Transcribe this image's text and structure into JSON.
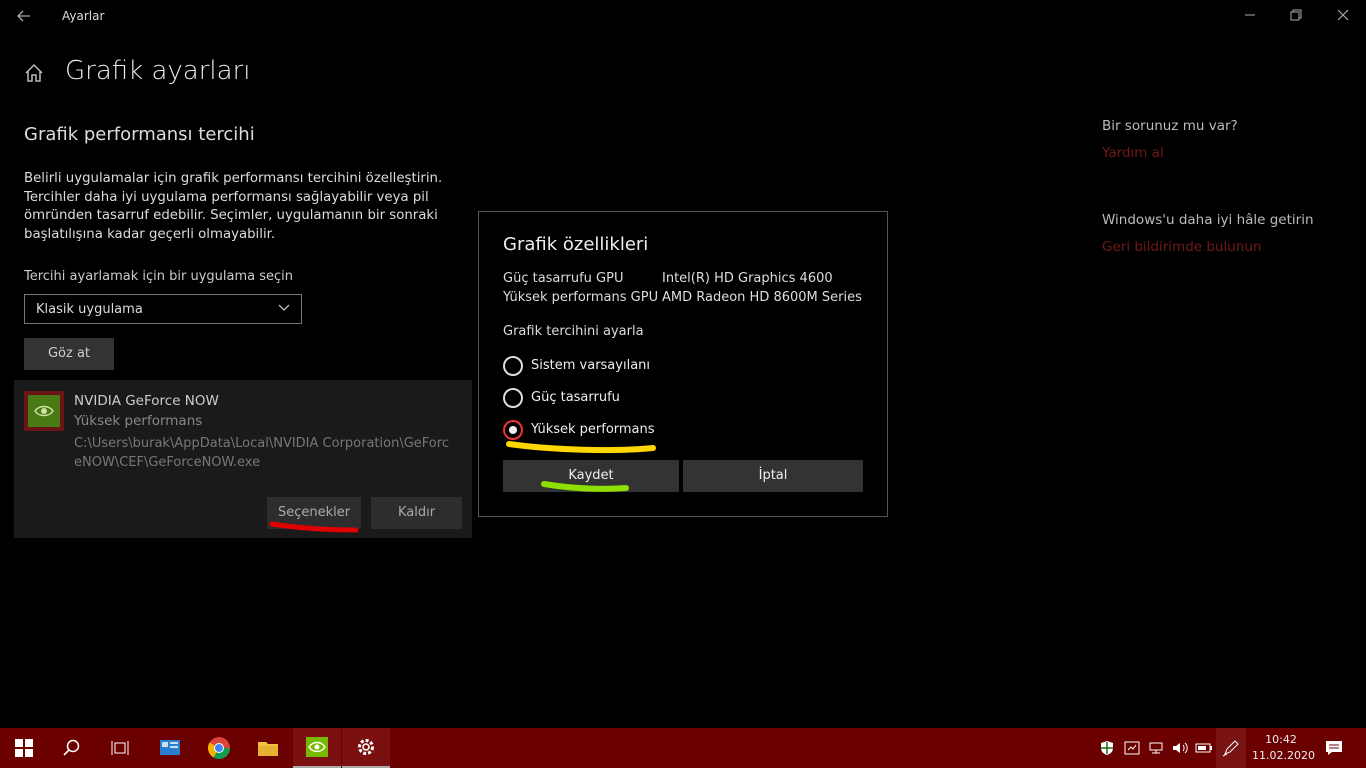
{
  "window": {
    "title": "Ayarlar",
    "icons": [
      "back-arrow-icon",
      "minimize-icon",
      "restore-icon",
      "close-icon"
    ]
  },
  "page": {
    "title": "Grafik ayarları",
    "section_title": "Grafik performansı tercihi",
    "description": "Belirli uygulamalar için grafik performansı tercihini özelleştirin. Tercihler daha iyi uygulama performansı sağlayabilir veya pil ömründen tasarruf edebilir. Seçimler, uygulamanın bir sonraki başlatılışına kadar geçerli olmayabilir.",
    "select_label": "Tercihi ayarlamak için bir uygulama seçin",
    "select_value": "Klasik uygulama",
    "browse_button": "Göz at"
  },
  "app_card": {
    "name": "NVIDIA GeForce NOW",
    "preference": "Yüksek performans",
    "path": "C:\\Users\\burak\\AppData\\Local\\NVIDIA Corporation\\GeForceNOW\\CEF\\GeForceNOW.exe",
    "options_button": "Seçenekler",
    "remove_button": "Kaldır"
  },
  "right_panel": {
    "question": "Bir sorunuz mu var?",
    "help_link": "Yardım al",
    "improve": "Windows'u daha iyi hâle getirin",
    "feedback_link": "Geri bildirimde bulunun"
  },
  "dialog": {
    "title": "Grafik özellikleri",
    "power_gpu_label": "Güç tasarrufu GPU",
    "power_gpu_value": "Intel(R) HD Graphics 4600",
    "perf_gpu_label": "Yüksek performans GPU",
    "perf_gpu_value": "AMD Radeon HD 8600M Series",
    "pref_label": "Grafik tercihini ayarla",
    "options": [
      {
        "label": "Sistem varsayılanı",
        "selected": false
      },
      {
        "label": "Güç tasarrufu",
        "selected": false
      },
      {
        "label": "Yüksek performans",
        "selected": true
      }
    ],
    "save_button": "Kaydet",
    "cancel_button": "İptal"
  },
  "annotations": {
    "red_underline_color": "#e00000",
    "yellow_underline_color": "#ffd700",
    "green_underline_color": "#8ee000"
  },
  "taskbar": {
    "time": "10:42",
    "date": "11.02.2020",
    "color": "#6a0000",
    "apps": [
      "windows-start-icon",
      "search-icon",
      "task-view-icon",
      "control-panel-icon",
      "chrome-icon",
      "file-explorer-icon",
      "nvidia-icon",
      "settings-icon"
    ],
    "tray": [
      "security-icon",
      "tray-app-icon",
      "network-icon",
      "volume-icon",
      "battery-icon",
      "pen-icon",
      "notification-icon"
    ]
  }
}
